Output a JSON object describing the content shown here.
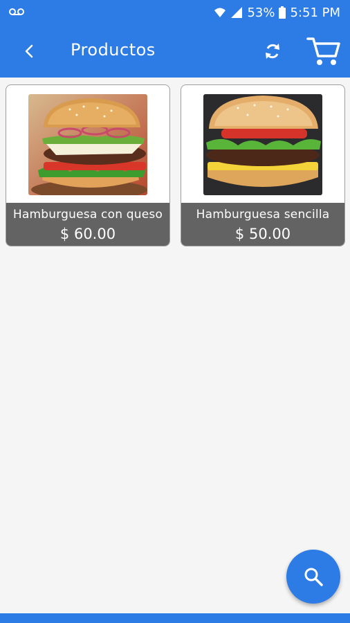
{
  "status_bar": {
    "battery": "53%",
    "time": "5:51 PM",
    "icons": [
      "voicemail-icon",
      "wifi-icon",
      "signal-icon",
      "battery-icon"
    ]
  },
  "app_bar": {
    "title": "Productos",
    "icons": [
      "back-icon",
      "refresh-icon",
      "cart-icon"
    ]
  },
  "products": [
    {
      "name": "Hamburguesa con queso",
      "price": "$ 60.00"
    },
    {
      "name": "Hamburguesa sencilla",
      "price": "$ 50.00"
    }
  ],
  "fab": {
    "icon": "search-icon"
  },
  "colors": {
    "primary": "#2d7be5",
    "card_footer": "#636363",
    "background": "#f5f5f5"
  }
}
